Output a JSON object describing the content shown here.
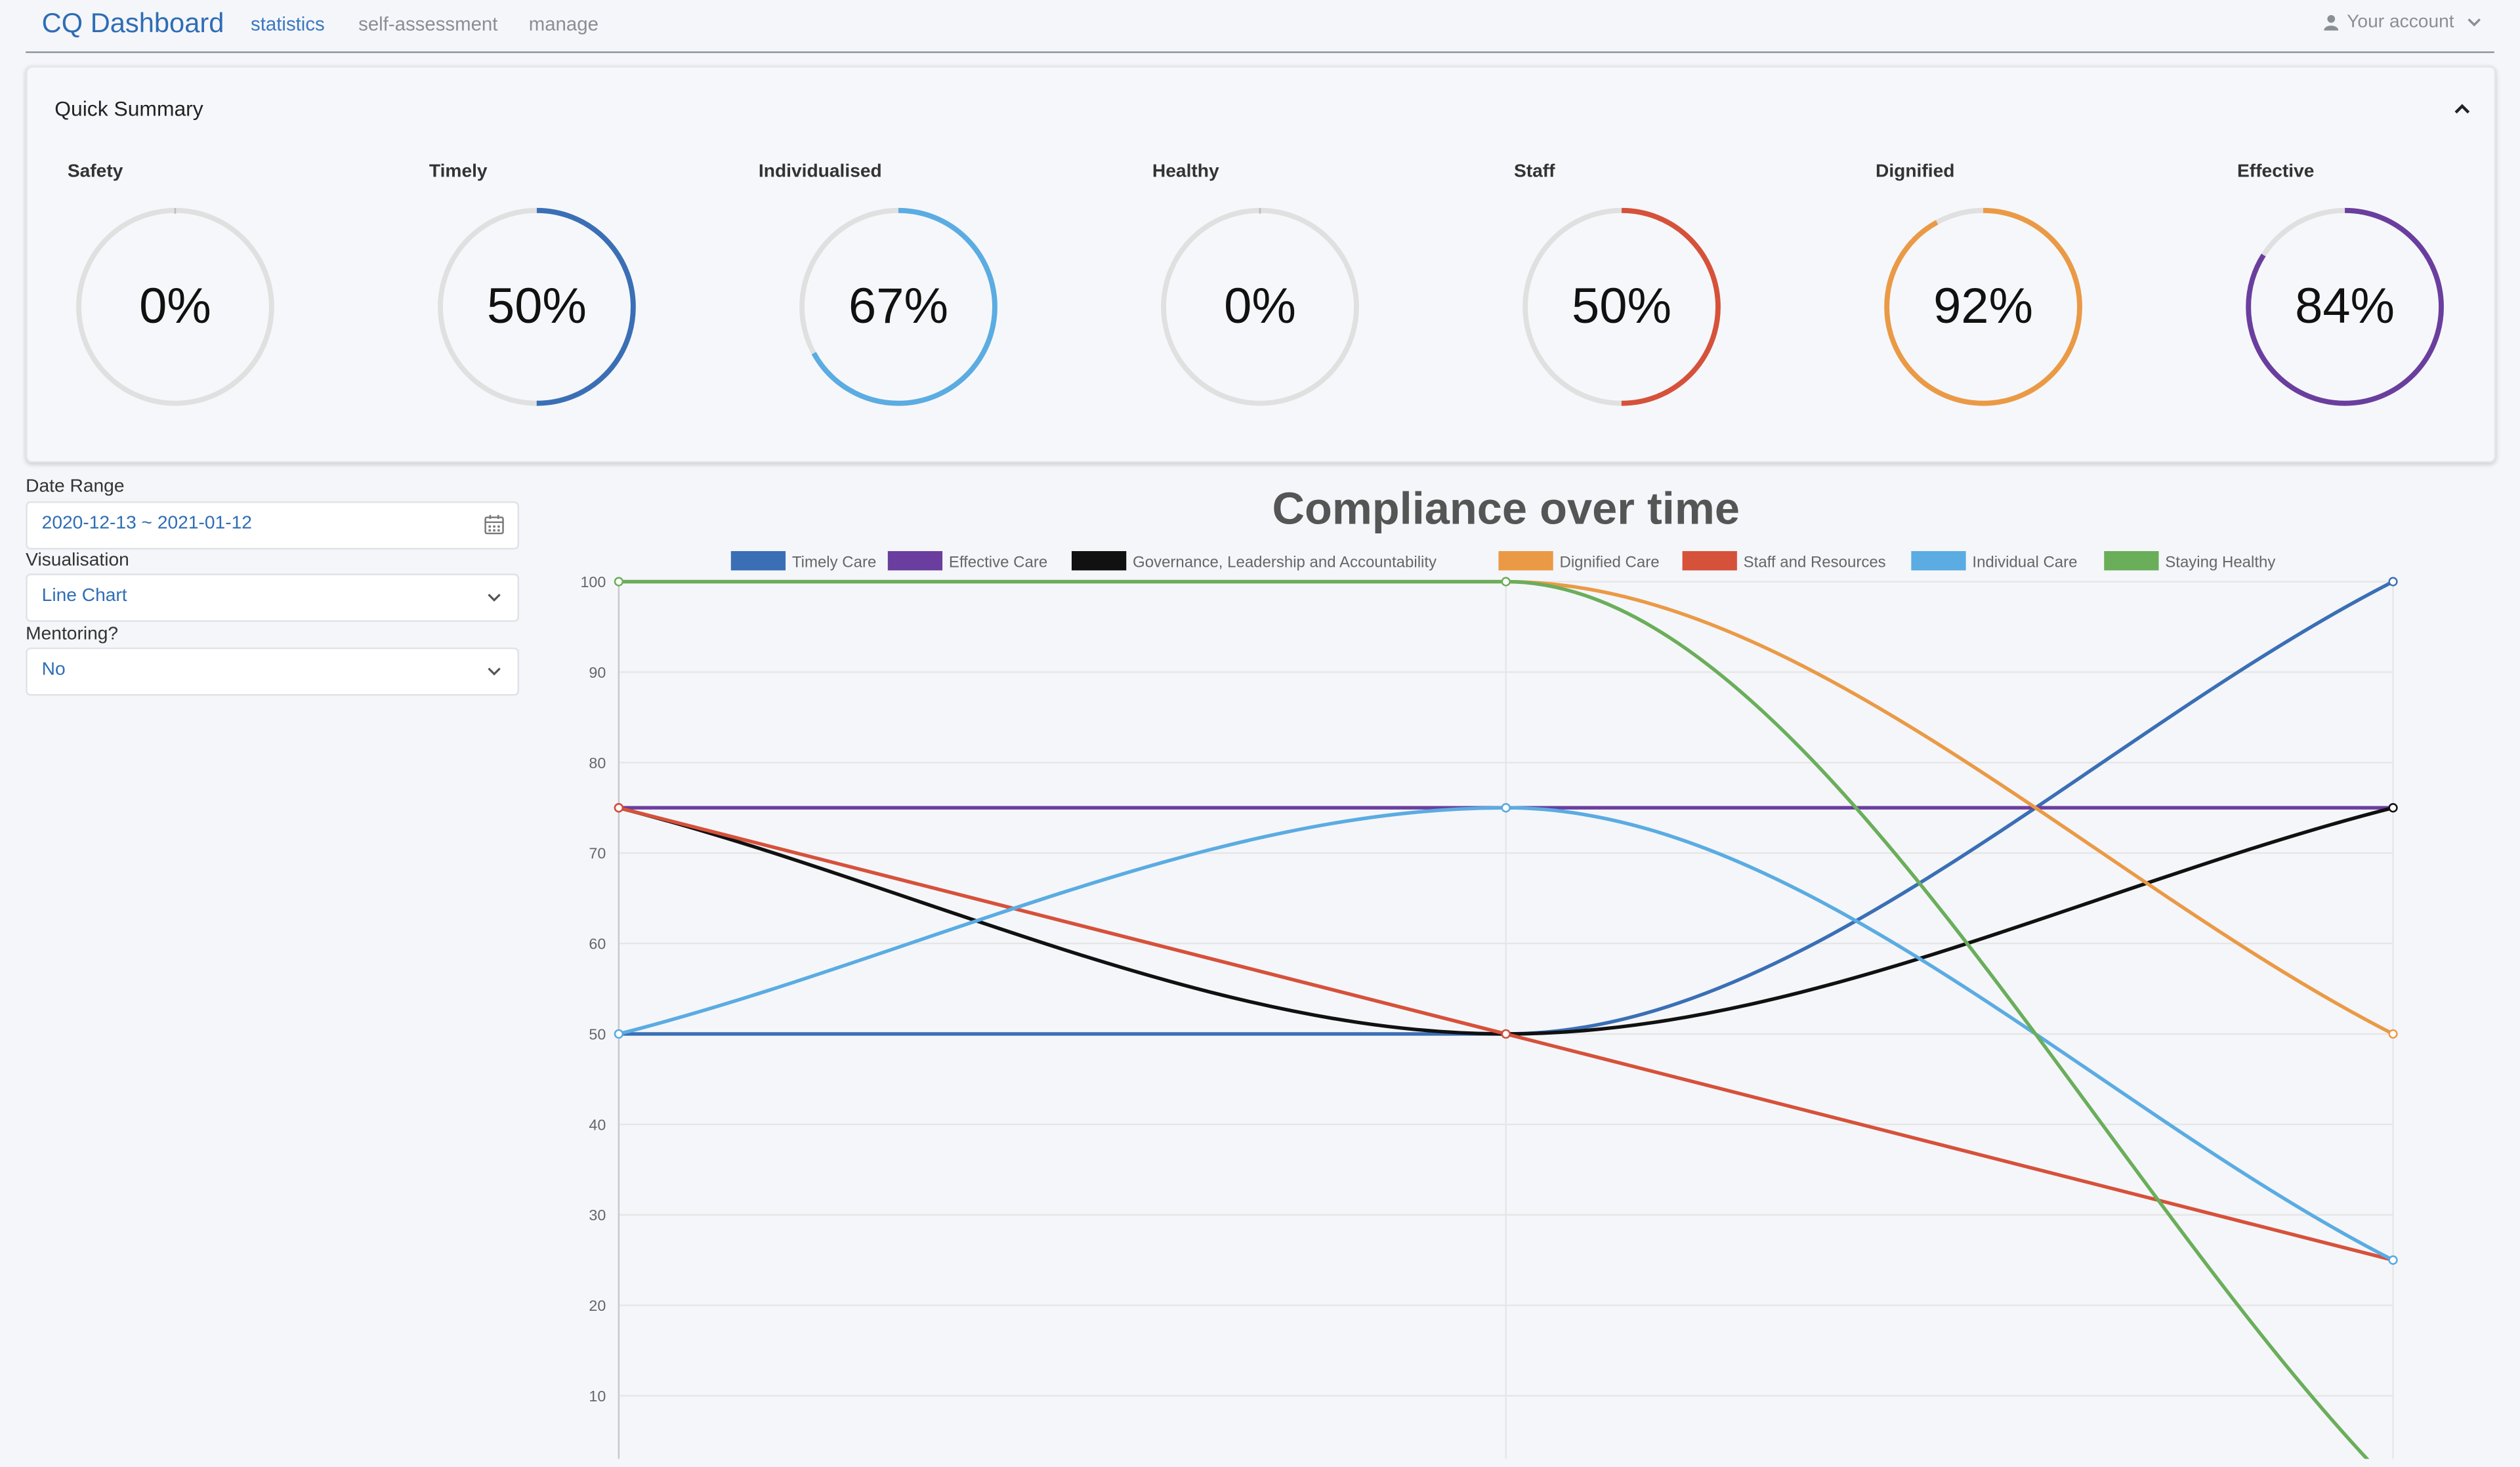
{
  "nav": {
    "brand": "CQ Dashboard",
    "links": [
      "statistics",
      "self-assessment",
      "manage"
    ],
    "account": "Your account"
  },
  "summary": {
    "title": "Quick Summary",
    "gauges": [
      {
        "label": "Safety",
        "value": 0,
        "text": "0%",
        "color": "#3a6fb5"
      },
      {
        "label": "Timely",
        "value": 50,
        "text": "50%",
        "color": "#3a6fb5"
      },
      {
        "label": "Individualised",
        "value": 67,
        "text": "67%",
        "color": "#5aace2"
      },
      {
        "label": "Healthy",
        "value": 0,
        "text": "0%",
        "color": "#6aae5a"
      },
      {
        "label": "Staff",
        "value": 50,
        "text": "50%",
        "color": "#d6513a"
      },
      {
        "label": "Dignified",
        "value": 92,
        "text": "92%",
        "color": "#ea9a45"
      },
      {
        "label": "Effective",
        "value": 84,
        "text": "84%",
        "color": "#6a3e9e"
      }
    ]
  },
  "filters": {
    "date_range_label": "Date Range",
    "date_range_value": "2020-12-13 ~ 2021-01-12",
    "visualisation_label": "Visualisation",
    "visualisation_value": "Line Chart",
    "mentoring_label": "Mentoring?",
    "mentoring_value": "No"
  },
  "chart_data": {
    "type": "line",
    "title": "Compliance over time",
    "xlabel": "",
    "ylabel": "",
    "ylim": [
      0,
      100
    ],
    "yticks": [
      10,
      20,
      30,
      40,
      50,
      60,
      70,
      80,
      90,
      100
    ],
    "x": [
      0,
      1,
      2
    ],
    "grid": true,
    "legend": "top",
    "series": [
      {
        "name": "Timely Care",
        "color": "#3a6fb5",
        "values": [
          50,
          50,
          100
        ]
      },
      {
        "name": "Effective Care",
        "color": "#6a3e9e",
        "values": [
          75,
          75,
          75
        ]
      },
      {
        "name": "Governance, Leadership and Accountability",
        "color": "#111111",
        "values": [
          75,
          50,
          75
        ]
      },
      {
        "name": "Dignified Care",
        "color": "#ea9a45",
        "values": [
          100,
          100,
          50
        ]
      },
      {
        "name": "Staff and Resources",
        "color": "#d6513a",
        "values": [
          75,
          50,
          25
        ]
      },
      {
        "name": "Individual Care",
        "color": "#5aace2",
        "values": [
          50,
          75,
          25
        ]
      },
      {
        "name": "Staying Healthy",
        "color": "#6aae5a",
        "values": [
          100,
          100,
          0
        ]
      }
    ]
  }
}
